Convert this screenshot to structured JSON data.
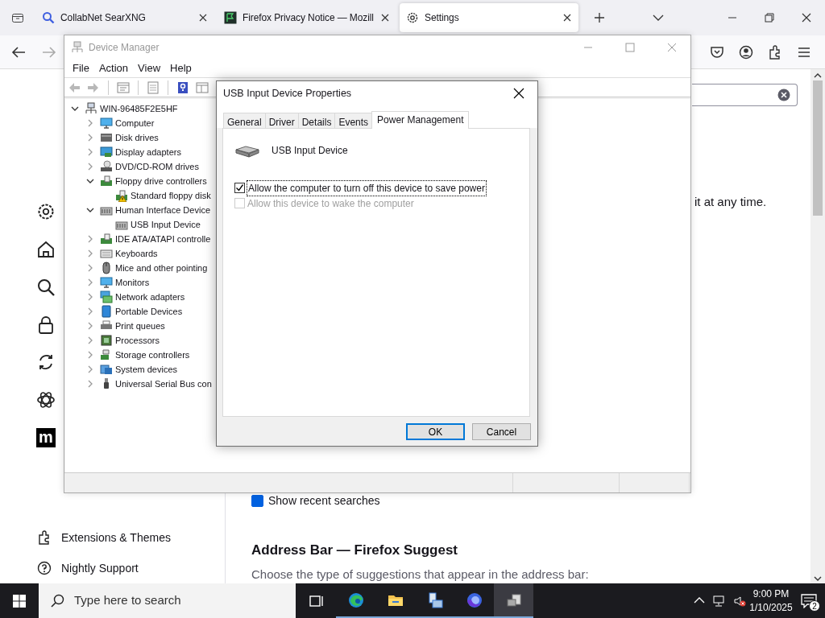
{
  "browser": {
    "tabs": [
      {
        "title": "CollabNet SearXNG",
        "kind": "search",
        "selected": false
      },
      {
        "title": "Firefox Privacy Notice — Mozill",
        "kind": "page",
        "selected": false
      },
      {
        "title": "Settings",
        "kind": "settings",
        "selected": true
      }
    ],
    "sidebar": {
      "logo_text": "m",
      "items": [
        {
          "label": "Extensions & Themes",
          "kind": "extensions"
        },
        {
          "label": "Nightly Support",
          "kind": "support"
        }
      ]
    },
    "content": {
      "partial_text": "it at any time.",
      "checkbox": {
        "label": "Show recent searches",
        "checked": true
      },
      "heading": "Address Bar — Firefox Suggest",
      "description": "Choose the type of suggestions that appear in the address bar:"
    }
  },
  "device_manager": {
    "title": "Device Manager",
    "active": false,
    "menu": [
      "File",
      "Action",
      "View",
      "Help"
    ],
    "tree": {
      "label": "WIN-96485F2E5HF",
      "kind": "computer",
      "expanded": true,
      "children": [
        {
          "label": "Computer",
          "kind": "monitor",
          "expanded": false
        },
        {
          "label": "Disk drives",
          "kind": "disk",
          "expanded": false
        },
        {
          "label": "Display adapters",
          "kind": "display",
          "expanded": false
        },
        {
          "label": "DVD/CD-ROM drives",
          "kind": "dvd",
          "expanded": false
        },
        {
          "label": "Floppy drive controllers",
          "kind": "controller",
          "expanded": true,
          "children": [
            {
              "label": "Standard floppy disk",
              "kind": "controller",
              "warning": true
            }
          ]
        },
        {
          "label": "Human Interface Device",
          "kind": "hid",
          "expanded": true,
          "children": [
            {
              "label": "USB Input Device",
              "kind": "hid",
              "warning": false
            }
          ]
        },
        {
          "label": "IDE ATA/ATAPI controlle",
          "kind": "controller",
          "expanded": false
        },
        {
          "label": "Keyboards",
          "kind": "keyboard",
          "expanded": false
        },
        {
          "label": "Mice and other pointing",
          "kind": "mouse",
          "expanded": false
        },
        {
          "label": "Monitors",
          "kind": "monitor",
          "expanded": false
        },
        {
          "label": "Network adapters",
          "kind": "network",
          "expanded": false
        },
        {
          "label": "Portable Devices",
          "kind": "portable",
          "expanded": false
        },
        {
          "label": "Print queues",
          "kind": "printer",
          "expanded": false
        },
        {
          "label": "Processors",
          "kind": "processor",
          "expanded": false
        },
        {
          "label": "Storage controllers",
          "kind": "storage",
          "expanded": false
        },
        {
          "label": "System devices",
          "kind": "system",
          "expanded": false
        },
        {
          "label": "Universal Serial Bus con",
          "kind": "usb",
          "expanded": false
        }
      ]
    }
  },
  "dialog": {
    "title": "USB Input Device Properties",
    "tabs": [
      {
        "label": "General",
        "selected": false
      },
      {
        "label": "Driver",
        "selected": false
      },
      {
        "label": "Details",
        "selected": false
      },
      {
        "label": "Events",
        "selected": false
      },
      {
        "label": "Power Management",
        "selected": true
      }
    ],
    "device_name": "USB Input Device",
    "options": [
      {
        "label": "Allow the computer to turn off this device to save power",
        "checked": true,
        "disabled": false,
        "focused": true
      },
      {
        "label": "Allow this device to wake the computer",
        "checked": false,
        "disabled": true,
        "focused": false
      }
    ],
    "buttons": [
      {
        "label": "OK",
        "default": true
      },
      {
        "label": "Cancel",
        "default": false
      }
    ]
  },
  "taskbar": {
    "search_placeholder": "Type here to search",
    "apps": [
      {
        "kind": "taskview",
        "open": false,
        "active": false
      },
      {
        "kind": "edge",
        "open": true,
        "active": false
      },
      {
        "kind": "folder",
        "open": true,
        "active": false
      },
      {
        "kind": "server",
        "open": true,
        "active": false
      },
      {
        "kind": "firefox",
        "open": true,
        "active": false
      },
      {
        "kind": "devices",
        "open": true,
        "active": true
      }
    ],
    "time": "9:00 PM",
    "date": "1/10/2025",
    "notifications": "2"
  }
}
